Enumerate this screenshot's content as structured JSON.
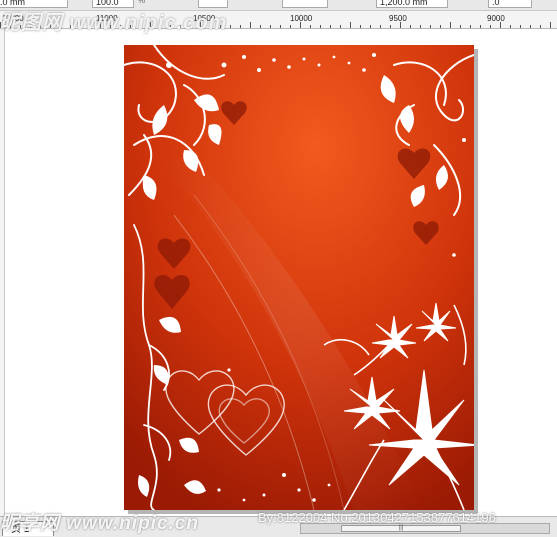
{
  "toolbar": {
    "field1_value": ".0 mm",
    "field2_value": "100.0",
    "field2_unit": "%",
    "field3_value": "1,200.0 mm",
    "field4_value": ".0"
  },
  "ruler": {
    "labels": [
      "11000",
      "11000",
      "10500",
      "10000",
      "9500",
      "9000"
    ]
  },
  "page_tab": {
    "label": "页 1"
  },
  "watermark": {
    "top_text": "昵图网 www.nipic.com",
    "bottom_text": "昵享网 www.nipic.cn",
    "info_text": "By:8122004 No:20130427153877614196"
  },
  "colors": {
    "artwork_base": "#cc2c06",
    "artwork_light": "#f0501a",
    "artwork_dark": "#8a1703",
    "ornament": "#ffffff"
  }
}
